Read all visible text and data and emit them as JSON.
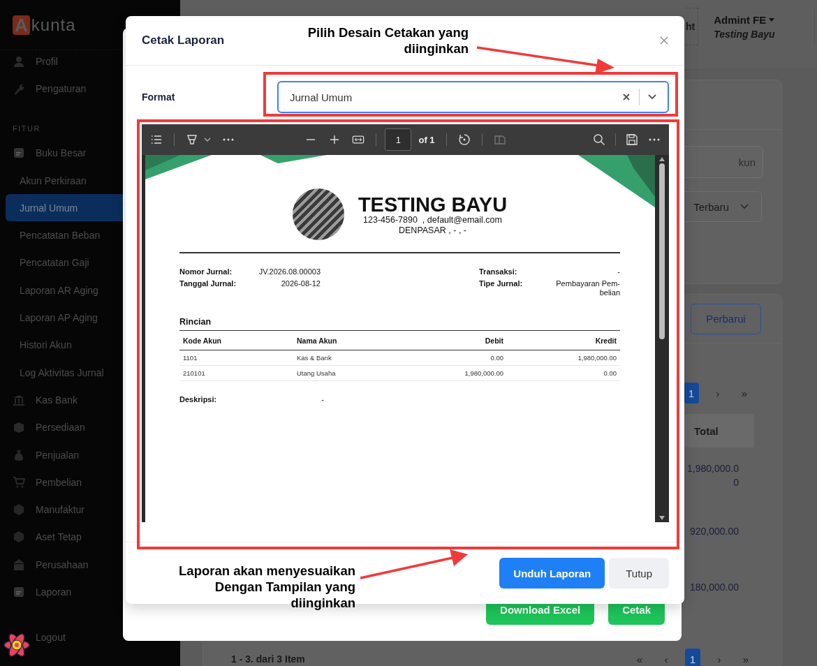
{
  "sidebar": {
    "logo": {
      "mark": "A",
      "text": "kunta"
    },
    "items": [
      {
        "kind": "menu",
        "label": "Profil",
        "selected": false
      },
      {
        "kind": "menu",
        "label": "Pengaturan",
        "selected": false
      },
      {
        "kind": "section",
        "label": "FITUR"
      },
      {
        "kind": "menu",
        "label": "Buku Besar",
        "selected": false
      },
      {
        "kind": "sub",
        "label": "Akun Perkiraan",
        "selected": false
      },
      {
        "kind": "sub",
        "label": "Jurnal Umum",
        "selected": true
      },
      {
        "kind": "sub",
        "label": "Pencatatan Beban",
        "selected": false
      },
      {
        "kind": "sub",
        "label": "Pencatatan Gaji",
        "selected": false
      },
      {
        "kind": "sub",
        "label": "Laporan AR Aging",
        "selected": false
      },
      {
        "kind": "sub",
        "label": "Laporan AP Aging",
        "selected": false
      },
      {
        "kind": "sub",
        "label": "Histori Akun",
        "selected": false
      },
      {
        "kind": "sub",
        "label": "Log Aktivitas Jurnal",
        "selected": false
      },
      {
        "kind": "menu",
        "label": "Kas Bank",
        "selected": false
      },
      {
        "kind": "menu",
        "label": "Persediaan",
        "selected": false
      },
      {
        "kind": "menu",
        "label": "Penjualan",
        "selected": false
      },
      {
        "kind": "menu",
        "label": "Pembelian",
        "selected": false
      },
      {
        "kind": "menu",
        "label": "Manufaktur",
        "selected": false
      },
      {
        "kind": "menu",
        "label": "Aset Tetap",
        "selected": false
      },
      {
        "kind": "menu",
        "label": "Perusahaan",
        "selected": false
      },
      {
        "kind": "menu",
        "label": "Laporan",
        "selected": false
      }
    ],
    "logout": "Logout"
  },
  "header": {
    "button_fragment": "ht",
    "user_name": "Admint FE",
    "company": "Testing Bayu"
  },
  "filters": {
    "search": {
      "placeholder": "kun"
    },
    "sort": "Terbaru"
  },
  "refresh_button": "Perbarui",
  "top_pagination": [
    {
      "label": "1",
      "selected": true
    },
    {
      "label": "›",
      "selected": false
    },
    {
      "label": "»",
      "selected": false
    }
  ],
  "table": {
    "column": "Total",
    "rows": [
      "1,980,000.00",
      "920,000.00",
      "180,000.00"
    ]
  },
  "footer": {
    "summary": "1 - 3. dari 3 Item",
    "pagination": [
      {
        "label": "«",
        "selected": false
      },
      {
        "label": "‹",
        "selected": false
      },
      {
        "label": "1",
        "selected": true
      },
      {
        "label": "›",
        "selected": false
      },
      {
        "label": "»",
        "selected": false
      }
    ]
  },
  "export_dialog": {
    "buttons": [
      "Download Excel",
      "Cetak"
    ]
  },
  "print_dialog": {
    "title": "Cetak Laporan",
    "format_label": "Format",
    "format_value": "Jurnal Umum",
    "viewer": {
      "page_input": "1",
      "page_count": "of 1"
    },
    "document": {
      "company": "TESTING BAYU",
      "contact": "123-456-7890  , default@email.com",
      "address": "DENPASAR , - , -",
      "fields_left": [
        {
          "label": "Nomor Jurnal:",
          "value": "JV.2026.08.00003"
        },
        {
          "label": "Tanggal Jurnal:",
          "value": "2026-08-12"
        }
      ],
      "fields_right": [
        {
          "label": "Transaksi:",
          "value": "-"
        },
        {
          "label": "Tipe Jurnal:",
          "value": "Pembayaran Pem-\nbelian"
        }
      ],
      "section": "Rincian",
      "columns": [
        "Kode Akun",
        "Nama Akun",
        "Debit",
        "Kredit"
      ],
      "rows": [
        [
          "1101",
          "Kas & Bank",
          "0.00",
          "1,980,000.00"
        ],
        [
          "210101",
          "Utang Usaha",
          "1,980,000.00",
          "0.00"
        ]
      ],
      "description_label": "Deskripsi:",
      "description": "-"
    },
    "buttons": [
      {
        "label": "Unduh Laporan",
        "kind": "primary"
      },
      {
        "label": "Tutup",
        "kind": "secondary"
      }
    ]
  },
  "annotations": [
    {
      "text": "Pilih Desain Cetakan yang\ndiinginkan"
    },
    {
      "text": "Laporan akan menyesuaikan\nDengan Tampilan yang\ndiinginkan"
    }
  ]
}
